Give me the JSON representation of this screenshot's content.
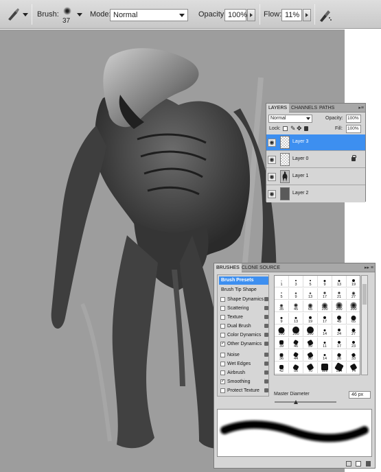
{
  "options_bar": {
    "brush_label": "Brush:",
    "brush_size": "37",
    "mode_label": "Mode:",
    "mode_value": "Normal",
    "opacity_label": "Opacity:",
    "opacity_value": "100%",
    "flow_label": "Flow:",
    "flow_value": "11%"
  },
  "layers_panel": {
    "tabs": [
      "LAYERS",
      "CHANNELS",
      "PATHS"
    ],
    "blend_mode": "Normal",
    "opacity_label": "Opacity:",
    "opacity_value": "100%",
    "lock_label": "Lock:",
    "fill_label": "Fill:",
    "fill_value": "100%",
    "layers": [
      {
        "name": "Layer 3",
        "selected": true
      },
      {
        "name": "Layer 0",
        "selected": false
      },
      {
        "name": "Layer 1",
        "selected": false
      },
      {
        "name": "Layer 2",
        "selected": false
      }
    ]
  },
  "brushes_panel": {
    "tabs": [
      "BRUSHES",
      "CLONE SOURCE"
    ],
    "presets_header": "Brush Presets",
    "tip_shape": "Brush Tip Shape",
    "options": [
      {
        "label": "Shape Dynamics",
        "checked": false
      },
      {
        "label": "Scattering",
        "checked": false
      },
      {
        "label": "Texture",
        "checked": false
      },
      {
        "label": "Dual Brush",
        "checked": false
      },
      {
        "label": "Color Dynamics",
        "checked": false
      },
      {
        "label": "Other Dynamics",
        "checked": true
      },
      {
        "label": "Noise",
        "checked": false
      },
      {
        "label": "Wet Edges",
        "checked": false
      },
      {
        "label": "Airbrush",
        "checked": false
      },
      {
        "label": "Smoothing",
        "checked": true
      },
      {
        "label": "Protect Texture",
        "checked": false
      }
    ],
    "grid_labels": [
      [
        "1",
        "3",
        "5",
        "9",
        "13",
        "19"
      ],
      [
        "5",
        "9",
        "13",
        "17",
        "21",
        "27"
      ],
      [
        "35",
        "45",
        "65",
        "100",
        "200",
        "300"
      ],
      [
        "9",
        "13",
        "19",
        "17",
        "45",
        "65"
      ],
      [
        "100",
        "200",
        "300",
        "14",
        "24",
        "27"
      ],
      [
        "39",
        "46",
        "59",
        "11",
        "17",
        "23"
      ],
      [
        "36",
        "44",
        "60",
        "14",
        "26",
        "33"
      ],
      [
        "42",
        "55",
        "70",
        "112",
        "134",
        "74"
      ]
    ],
    "master_diameter_label": "Master Diameter",
    "master_diameter_value": "46 px"
  },
  "colors": {
    "selection": "#3d8ff0",
    "canvas": "#9d9d9d",
    "panel": "#d6d6d6"
  }
}
